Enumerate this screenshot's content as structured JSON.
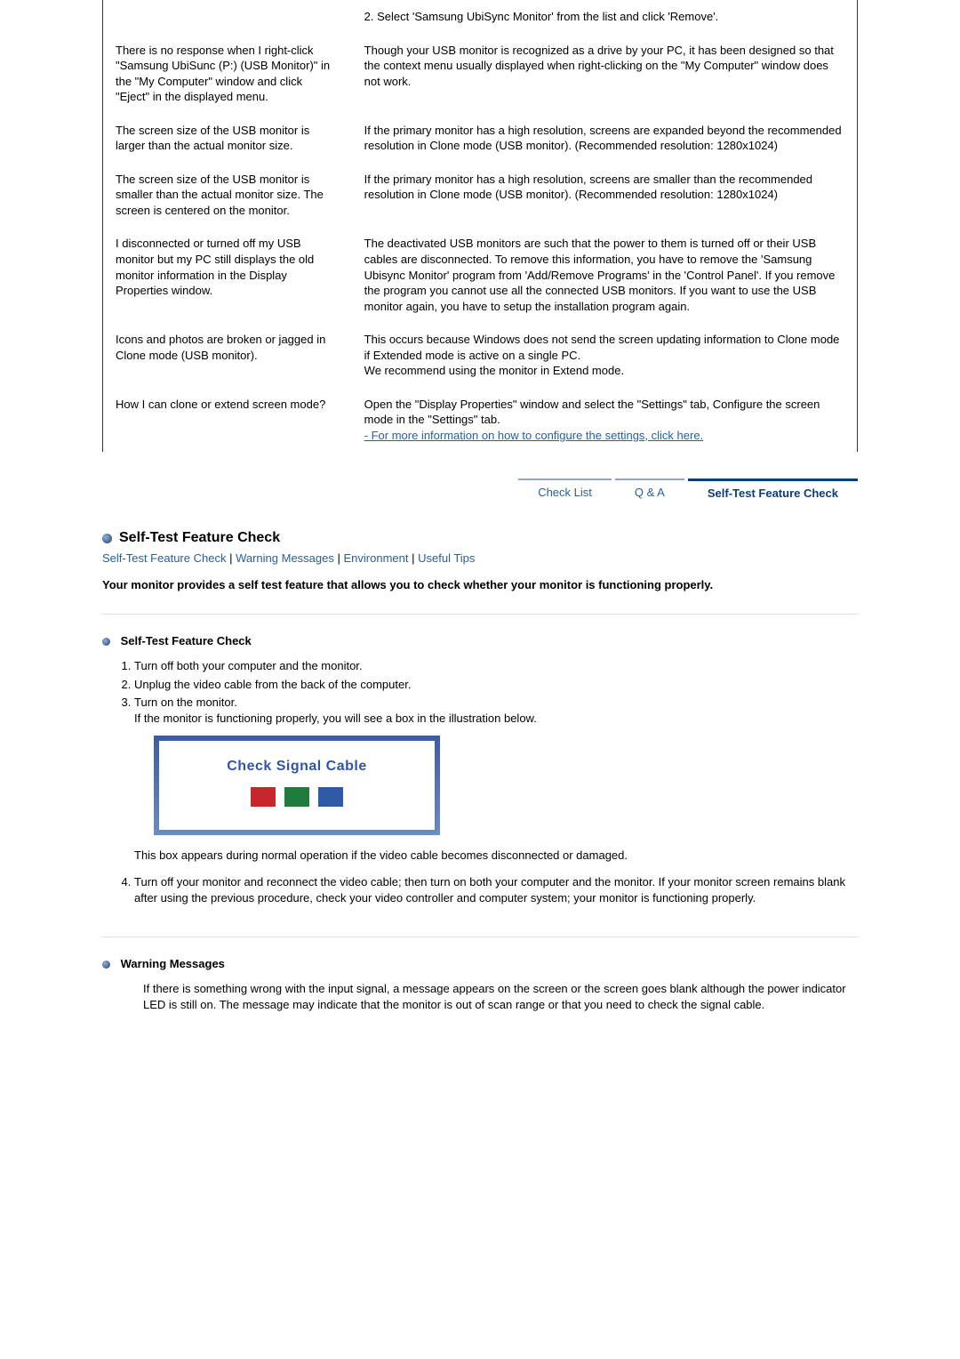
{
  "qa": [
    {
      "q": "",
      "a": "2. Select 'Samsung UbiSync Monitor' from the list and click 'Remove'."
    },
    {
      "q": "There is no response when I right-click \"Samsung UbiSunc (P:) (USB Monitor)\" in the \"My Computer\" window and click \"Eject\" in the displayed menu.",
      "a": "Though your USB monitor is recognized as a drive by your PC, it has been designed so that the context menu usually displayed when right-clicking on the \"My Computer\" window does not work."
    },
    {
      "q": "The screen size of the USB monitor is larger than the actual monitor size.",
      "a": "If the primary monitor has a high resolution, screens are expanded beyond the recommended resolution in Clone mode (USB monitor). (Recommended resolution: 1280x1024)"
    },
    {
      "q": "The screen size of the USB monitor is smaller than the actual monitor size. The screen is centered on the monitor.",
      "a": "If the primary monitor has a high resolution, screens are smaller than the recommended resolution in Clone mode (USB monitor). (Recommended resolution: 1280x1024)"
    },
    {
      "q": "I disconnected or turned off my USB monitor but my PC still displays the old monitor information in the Display Properties window.",
      "a": "The deactivated USB monitors are such that the power to them is turned off or their USB cables are disconnected. To remove this information, you have to remove the 'Samsung Ubisync Monitor' program from 'Add/Remove Programs' in the 'Control Panel'. If you remove the program you cannot use all the connected USB monitors. If you want to use the USB monitor again, you have to setup the installation program again."
    },
    {
      "q": "Icons and photos are broken or jagged in Clone mode (USB monitor).",
      "a": "This occurs because Windows does not send the screen updating information to Clone mode if Extended mode is active on a single PC.\nWe recommend using the monitor in Extend mode."
    },
    {
      "q": "How I can clone or extend screen mode?",
      "a": "Open the \"Display Properties\" window and select the \"Settings\" tab, Configure the screen mode in the \"Settings\" tab.",
      "link": "- For more information on how to configure the settings, click here."
    }
  ],
  "tabs": {
    "check": "Check List",
    "qa": "Q & A",
    "self": "Self-Test Feature Check"
  },
  "section": {
    "title": "Self-Test Feature Check",
    "nav": {
      "self": "Self-Test Feature Check",
      "warn": "Warning Messages",
      "env": "Environment",
      "tips": "Useful Tips"
    },
    "intro": "Your monitor provides a self test feature that allows you to check whether your monitor is functioning properly.",
    "sub1_title": "Self-Test Feature Check",
    "steps": [
      "Turn off both your computer and the monitor.",
      "Unplug the video cable from the back of the computer.",
      "Turn on the monitor."
    ],
    "step3_extra": "If the monitor is functioning properly, you will see a box in the illustration below.",
    "check_cable": "Check Signal Cable",
    "after_box": "This box appears during normal operation if the video cable becomes disconnected or damaged.",
    "step4": "Turn off your monitor and reconnect the video cable; then turn on both your computer and the monitor. If your monitor screen remains blank after using the previous procedure, check your video controller and computer system; your monitor is functioning properly.",
    "warn_title": "Warning Messages",
    "warn_body": "If there is something wrong with the input signal, a message appears on the screen or the screen goes blank although the power indicator LED is still on. The message may indicate that the monitor is out of scan range or that you need to check the signal cable."
  }
}
